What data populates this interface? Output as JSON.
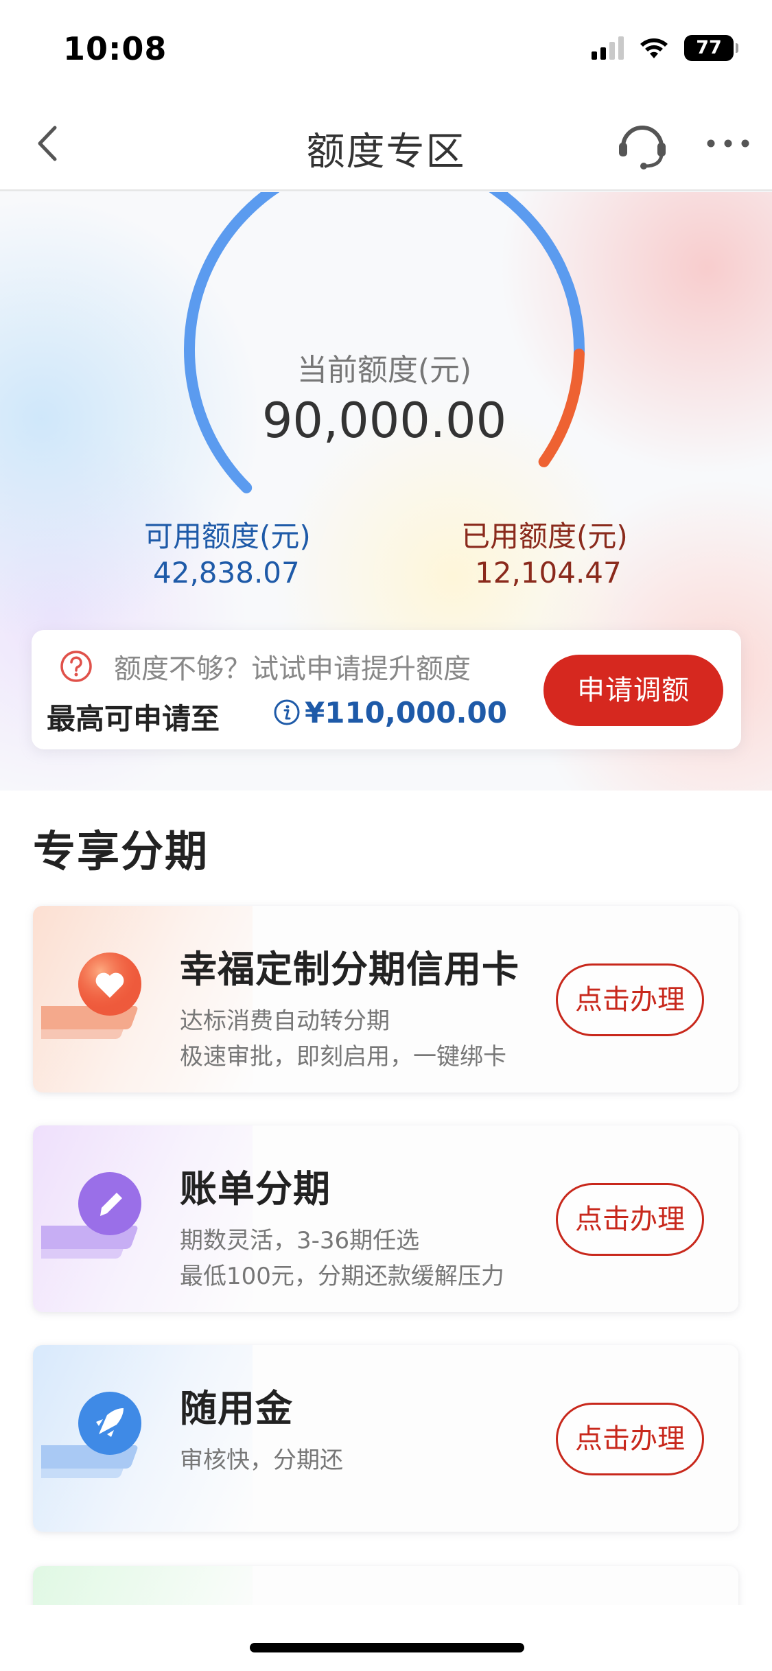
{
  "status_bar": {
    "time": "10:08",
    "battery": "77"
  },
  "nav": {
    "title": "额度专区"
  },
  "credit": {
    "gauge_label": "当前额度(元)",
    "total": "90,000.00",
    "available_label": "可用额度(元)",
    "available_value": "42,838.07",
    "used_label": "已用额度(元)",
    "used_value": "12,104.47",
    "gauge_used_fraction": 0.13
  },
  "apply": {
    "hint": "额度不够？试试申请提升额度",
    "max_label": "最高可申请至",
    "max_amount": "¥110,000.00",
    "button": "申请调额"
  },
  "section": {
    "title": "专享分期"
  },
  "products": [
    {
      "title": "幸福定制分期信用卡",
      "desc1": "达标消费自动转分期",
      "desc2": "极速审批，即刻启用，一键绑卡",
      "button": "点击办理",
      "icon": "heart-icon",
      "color": "#ee5a3c"
    },
    {
      "title": "账单分期",
      "desc1": "期数灵活，3-36期任选",
      "desc2": "最低100元，分期还款缓解压力",
      "button": "点击办理",
      "icon": "pencil-icon",
      "color": "#9a6fe8"
    },
    {
      "title": "随用金",
      "desc1": "审核快，分期还",
      "button": "点击办理",
      "icon": "rocket-icon",
      "color": "#3f8ae6"
    }
  ],
  "colors": {
    "accent_red": "#d6281f",
    "gauge_blue": "#5b9bef",
    "gauge_orange": "#ee6232",
    "available_blue": "#1e5aa8",
    "used_brown": "#8a2a1c"
  }
}
